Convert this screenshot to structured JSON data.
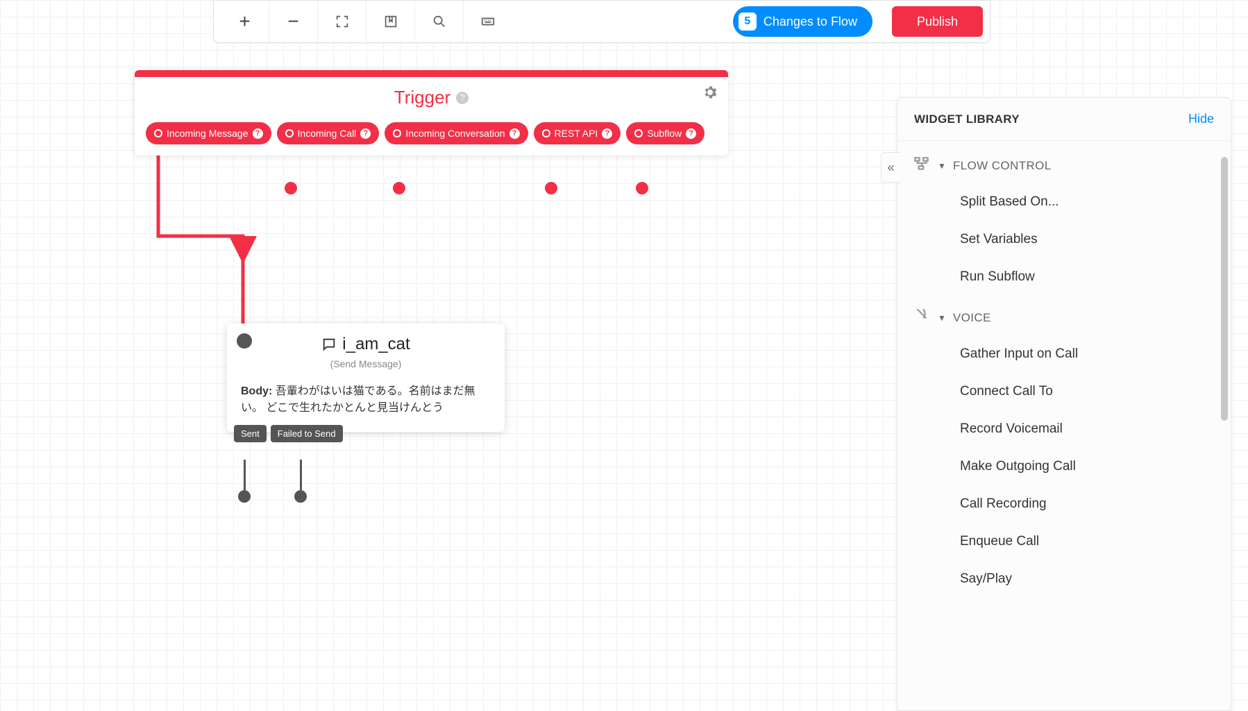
{
  "toolbar": {
    "changes_count": "5",
    "changes_label": "Changes to Flow",
    "publish_label": "Publish"
  },
  "trigger": {
    "title": "Trigger",
    "outputs": [
      "Incoming Message",
      "Incoming Call",
      "Incoming Conversation",
      "REST API",
      "Subflow"
    ]
  },
  "widget": {
    "name": "i_am_cat",
    "type": "(Send Message)",
    "body_label": "Body:",
    "body_text": "吾輩わがはいは猫である。名前はまだ無い。 どこで生れたかとんと見当けんとう",
    "outputs": [
      "Sent",
      "Failed to Send"
    ]
  },
  "sidebar": {
    "title": "WIDGET LIBRARY",
    "hide": "Hide",
    "sections": [
      {
        "name": "FLOW CONTROL",
        "items": [
          "Split Based On...",
          "Set Variables",
          "Run Subflow"
        ]
      },
      {
        "name": "VOICE",
        "items": [
          "Gather Input on Call",
          "Connect Call To",
          "Record Voicemail",
          "Make Outgoing Call",
          "Call Recording",
          "Enqueue Call",
          "Say/Play"
        ]
      }
    ]
  }
}
